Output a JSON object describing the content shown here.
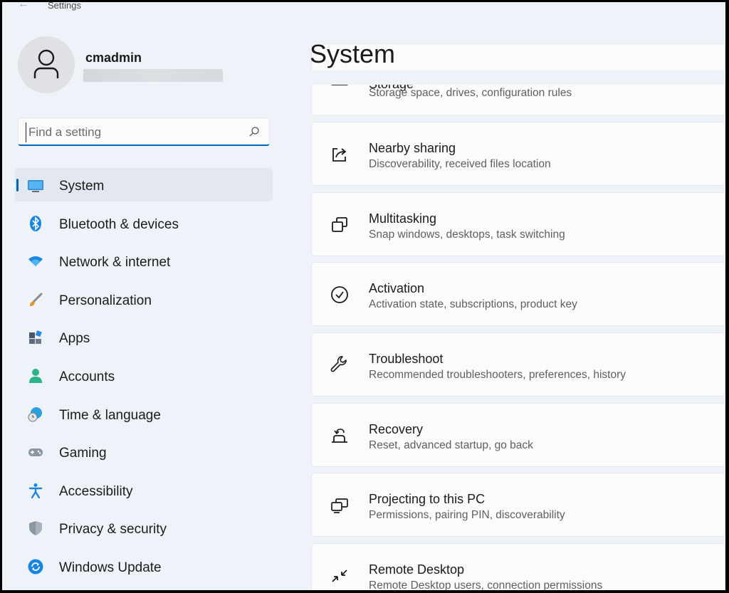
{
  "window": {
    "title": "Settings"
  },
  "profile": {
    "username": "cmadmin"
  },
  "search": {
    "placeholder": "Find a setting"
  },
  "nav": [
    {
      "label": "System",
      "icon": "monitor-icon",
      "selected": true
    },
    {
      "label": "Bluetooth & devices",
      "icon": "bluetooth-icon"
    },
    {
      "label": "Network & internet",
      "icon": "wifi-icon"
    },
    {
      "label": "Personalization",
      "icon": "brush-icon"
    },
    {
      "label": "Apps",
      "icon": "apps-icon"
    },
    {
      "label": "Accounts",
      "icon": "person-icon"
    },
    {
      "label": "Time & language",
      "icon": "globe-clock-icon"
    },
    {
      "label": "Gaming",
      "icon": "gamepad-icon"
    },
    {
      "label": "Accessibility",
      "icon": "accessibility-icon"
    },
    {
      "label": "Privacy & security",
      "icon": "shield-icon"
    },
    {
      "label": "Windows Update",
      "icon": "update-icon"
    }
  ],
  "main": {
    "title": "System",
    "cards": [
      {
        "title": "Storage",
        "desc": "Storage space, drives, configuration rules",
        "icon": "storage-icon"
      },
      {
        "title": "Nearby sharing",
        "desc": "Discoverability, received files location",
        "icon": "share-icon"
      },
      {
        "title": "Multitasking",
        "desc": "Snap windows, desktops, task switching",
        "icon": "multitasking-icon"
      },
      {
        "title": "Activation",
        "desc": "Activation state, subscriptions, product key",
        "icon": "check-circle-icon"
      },
      {
        "title": "Troubleshoot",
        "desc": "Recommended troubleshooters, preferences, history",
        "icon": "wrench-icon"
      },
      {
        "title": "Recovery",
        "desc": "Reset, advanced startup, go back",
        "icon": "recovery-icon"
      },
      {
        "title": "Projecting to this PC",
        "desc": "Permissions, pairing PIN, discoverability",
        "icon": "projecting-icon"
      },
      {
        "title": "Remote Desktop",
        "desc": "Remote Desktop users, connection permissions",
        "icon": "remote-desktop-icon"
      }
    ]
  },
  "colors": {
    "accent": "#0067c0",
    "background": "#eef2f9",
    "card": "#fbfbfb"
  }
}
